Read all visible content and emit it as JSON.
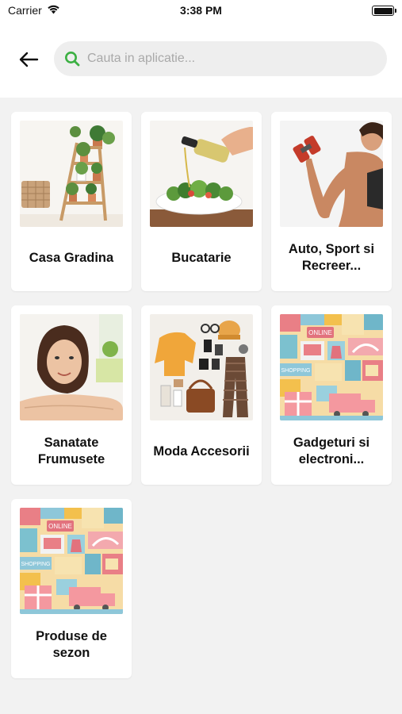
{
  "status_bar": {
    "carrier": "Carrier",
    "time": "3:38 PM"
  },
  "header": {
    "search_placeholder": "Cauta in aplicatie..."
  },
  "categories": [
    {
      "label": "Casa Gradina",
      "image": "plant-shelf-image"
    },
    {
      "label": "Bucatarie",
      "image": "salad-oil-image"
    },
    {
      "label": "Auto, Sport si Recreer...",
      "image": "dumbbell-arm-image"
    },
    {
      "label": "Sanatate Frumusete",
      "image": "woman-portrait-image"
    },
    {
      "label": "Moda Accesorii",
      "image": "fashion-flatlay-image"
    },
    {
      "label": "Gadgeturi si electroni...",
      "image": "shopping-collage-image"
    },
    {
      "label": "Produse de sezon",
      "image": "shopping-collage-image"
    }
  ],
  "collage_text": {
    "online": "ONLINE",
    "shopping": "SHOPPING"
  },
  "colors": {
    "accent": "#3cb043",
    "background": "#f2f2f2",
    "card": "#ffffff",
    "search_field": "#eeeeee"
  }
}
